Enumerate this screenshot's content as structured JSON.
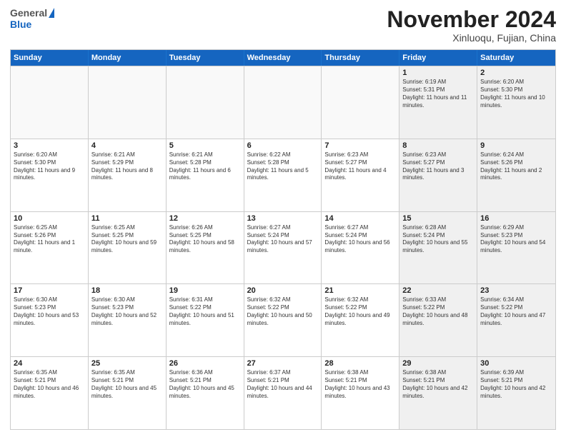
{
  "header": {
    "logo_general": "General",
    "logo_blue": "Blue",
    "month": "November 2024",
    "location": "Xinluoqu, Fujian, China"
  },
  "weekdays": [
    "Sunday",
    "Monday",
    "Tuesday",
    "Wednesday",
    "Thursday",
    "Friday",
    "Saturday"
  ],
  "rows": [
    [
      {
        "day": "",
        "text": "",
        "empty": true
      },
      {
        "day": "",
        "text": "",
        "empty": true
      },
      {
        "day": "",
        "text": "",
        "empty": true
      },
      {
        "day": "",
        "text": "",
        "empty": true
      },
      {
        "day": "",
        "text": "",
        "empty": true
      },
      {
        "day": "1",
        "text": "Sunrise: 6:19 AM\nSunset: 5:31 PM\nDaylight: 11 hours and 11 minutes.",
        "shaded": true
      },
      {
        "day": "2",
        "text": "Sunrise: 6:20 AM\nSunset: 5:30 PM\nDaylight: 11 hours and 10 minutes.",
        "shaded": true
      }
    ],
    [
      {
        "day": "3",
        "text": "Sunrise: 6:20 AM\nSunset: 5:30 PM\nDaylight: 11 hours and 9 minutes.",
        "shaded": false
      },
      {
        "day": "4",
        "text": "Sunrise: 6:21 AM\nSunset: 5:29 PM\nDaylight: 11 hours and 8 minutes.",
        "shaded": false
      },
      {
        "day": "5",
        "text": "Sunrise: 6:21 AM\nSunset: 5:28 PM\nDaylight: 11 hours and 6 minutes.",
        "shaded": false
      },
      {
        "day": "6",
        "text": "Sunrise: 6:22 AM\nSunset: 5:28 PM\nDaylight: 11 hours and 5 minutes.",
        "shaded": false
      },
      {
        "day": "7",
        "text": "Sunrise: 6:23 AM\nSunset: 5:27 PM\nDaylight: 11 hours and 4 minutes.",
        "shaded": false
      },
      {
        "day": "8",
        "text": "Sunrise: 6:23 AM\nSunset: 5:27 PM\nDaylight: 11 hours and 3 minutes.",
        "shaded": true
      },
      {
        "day": "9",
        "text": "Sunrise: 6:24 AM\nSunset: 5:26 PM\nDaylight: 11 hours and 2 minutes.",
        "shaded": true
      }
    ],
    [
      {
        "day": "10",
        "text": "Sunrise: 6:25 AM\nSunset: 5:26 PM\nDaylight: 11 hours and 1 minute.",
        "shaded": false
      },
      {
        "day": "11",
        "text": "Sunrise: 6:25 AM\nSunset: 5:25 PM\nDaylight: 10 hours and 59 minutes.",
        "shaded": false
      },
      {
        "day": "12",
        "text": "Sunrise: 6:26 AM\nSunset: 5:25 PM\nDaylight: 10 hours and 58 minutes.",
        "shaded": false
      },
      {
        "day": "13",
        "text": "Sunrise: 6:27 AM\nSunset: 5:24 PM\nDaylight: 10 hours and 57 minutes.",
        "shaded": false
      },
      {
        "day": "14",
        "text": "Sunrise: 6:27 AM\nSunset: 5:24 PM\nDaylight: 10 hours and 56 minutes.",
        "shaded": false
      },
      {
        "day": "15",
        "text": "Sunrise: 6:28 AM\nSunset: 5:24 PM\nDaylight: 10 hours and 55 minutes.",
        "shaded": true
      },
      {
        "day": "16",
        "text": "Sunrise: 6:29 AM\nSunset: 5:23 PM\nDaylight: 10 hours and 54 minutes.",
        "shaded": true
      }
    ],
    [
      {
        "day": "17",
        "text": "Sunrise: 6:30 AM\nSunset: 5:23 PM\nDaylight: 10 hours and 53 minutes.",
        "shaded": false
      },
      {
        "day": "18",
        "text": "Sunrise: 6:30 AM\nSunset: 5:23 PM\nDaylight: 10 hours and 52 minutes.",
        "shaded": false
      },
      {
        "day": "19",
        "text": "Sunrise: 6:31 AM\nSunset: 5:22 PM\nDaylight: 10 hours and 51 minutes.",
        "shaded": false
      },
      {
        "day": "20",
        "text": "Sunrise: 6:32 AM\nSunset: 5:22 PM\nDaylight: 10 hours and 50 minutes.",
        "shaded": false
      },
      {
        "day": "21",
        "text": "Sunrise: 6:32 AM\nSunset: 5:22 PM\nDaylight: 10 hours and 49 minutes.",
        "shaded": false
      },
      {
        "day": "22",
        "text": "Sunrise: 6:33 AM\nSunset: 5:22 PM\nDaylight: 10 hours and 48 minutes.",
        "shaded": true
      },
      {
        "day": "23",
        "text": "Sunrise: 6:34 AM\nSunset: 5:22 PM\nDaylight: 10 hours and 47 minutes.",
        "shaded": true
      }
    ],
    [
      {
        "day": "24",
        "text": "Sunrise: 6:35 AM\nSunset: 5:21 PM\nDaylight: 10 hours and 46 minutes.",
        "shaded": false
      },
      {
        "day": "25",
        "text": "Sunrise: 6:35 AM\nSunset: 5:21 PM\nDaylight: 10 hours and 45 minutes.",
        "shaded": false
      },
      {
        "day": "26",
        "text": "Sunrise: 6:36 AM\nSunset: 5:21 PM\nDaylight: 10 hours and 45 minutes.",
        "shaded": false
      },
      {
        "day": "27",
        "text": "Sunrise: 6:37 AM\nSunset: 5:21 PM\nDaylight: 10 hours and 44 minutes.",
        "shaded": false
      },
      {
        "day": "28",
        "text": "Sunrise: 6:38 AM\nSunset: 5:21 PM\nDaylight: 10 hours and 43 minutes.",
        "shaded": false
      },
      {
        "day": "29",
        "text": "Sunrise: 6:38 AM\nSunset: 5:21 PM\nDaylight: 10 hours and 42 minutes.",
        "shaded": true
      },
      {
        "day": "30",
        "text": "Sunrise: 6:39 AM\nSunset: 5:21 PM\nDaylight: 10 hours and 42 minutes.",
        "shaded": true
      }
    ]
  ]
}
